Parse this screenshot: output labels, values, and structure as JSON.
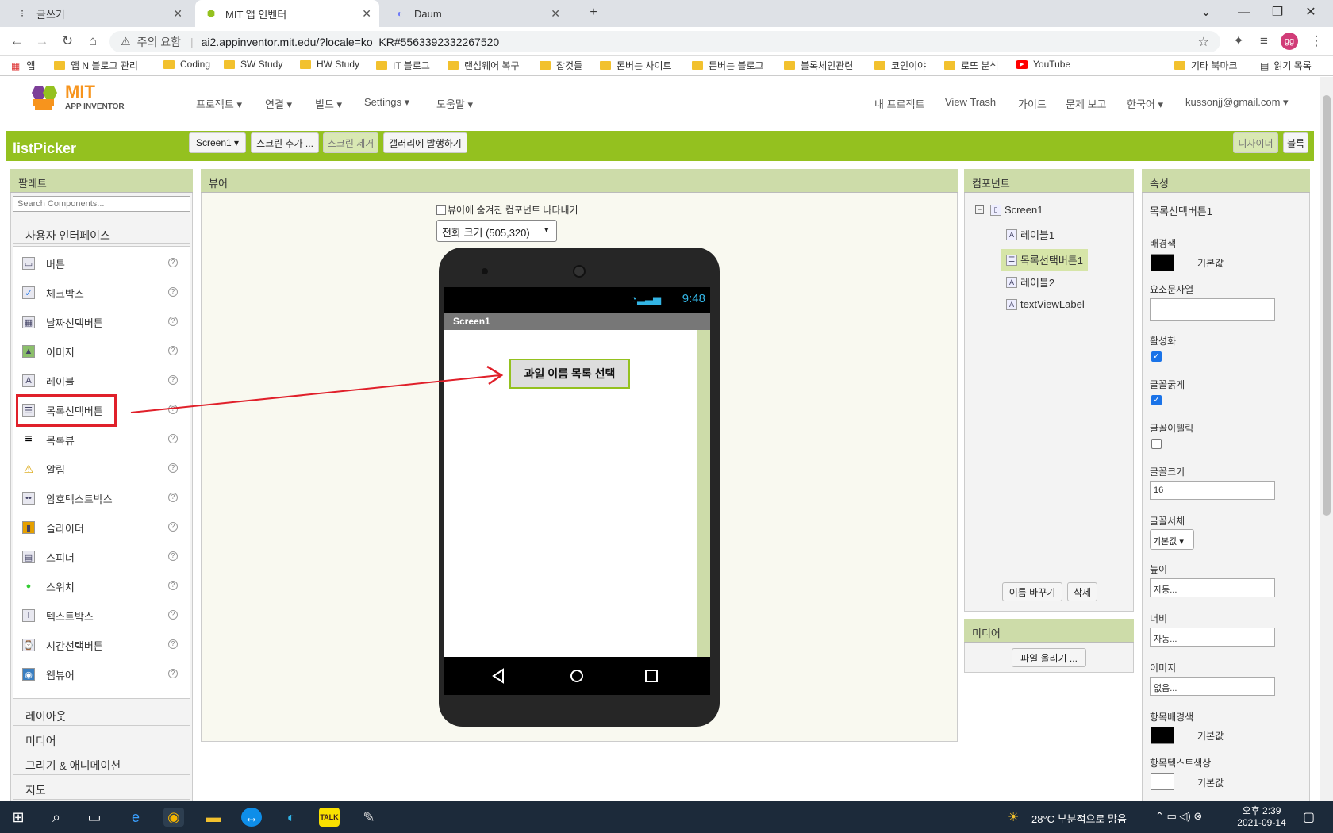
{
  "browser": {
    "tabs": [
      {
        "title": "글쓰기",
        "icon": "blog-icon"
      },
      {
        "title": "MIT 앱 인벤터",
        "icon": "appinventor-icon"
      },
      {
        "title": "Daum",
        "icon": "daum-icon"
      }
    ],
    "security_label": "주의 요함",
    "url": "ai2.appinventor.mit.edu/?locale=ko_KR#5563392332267520",
    "profile_initials": "gg",
    "bookmarks": [
      "앱",
      "앱 N 블로그 관리",
      "Coding",
      "SW Study",
      "HW Study",
      "IT 블로그",
      "랜섬웨어 복구",
      "잡것들",
      "돈버는 사이트",
      "돈버는 블로그",
      "블록체인관련",
      "코인이야",
      "로또 분석",
      "YouTube"
    ],
    "bookmarks_right": [
      "기타 북마크",
      "읽기 목록"
    ]
  },
  "appinventor": {
    "logo_mit": "MIT",
    "logo_sub": "APP INVENTOR",
    "menu": [
      "프로젝트 ▾",
      "연결 ▾",
      "빌드 ▾",
      "Settings ▾",
      "도움말 ▾"
    ],
    "menu_right": [
      "내 프로젝트",
      "View Trash",
      "가이드",
      "문제 보고",
      "한국어 ▾",
      "kussonjj@gmail.com ▾"
    ],
    "project_name": "listPicker",
    "toolbar": {
      "screen_select": "Screen1 ▾",
      "add_screen": "스크린 추가 ...",
      "remove_screen": "스크린 제거",
      "publish_gallery": "갤러리에 발행하기",
      "designer": "디자이너",
      "blocks": "블록"
    },
    "palette": {
      "title": "팔레트",
      "search_placeholder": "Search Components...",
      "category": "사용자 인터페이스",
      "items": [
        "버튼",
        "체크박스",
        "날짜선택버튼",
        "이미지",
        "레이블",
        "목록선택버튼",
        "목록뷰",
        "알림",
        "암호텍스트박스",
        "슬라이더",
        "스피너",
        "스위치",
        "텍스트박스",
        "시간선택버튼",
        "웹뷰어"
      ],
      "other_categories": [
        "레이아웃",
        "미디어",
        "그리기 & 애니메이션",
        "지도"
      ]
    },
    "viewer": {
      "title": "뷰어",
      "show_hidden": "뷰어에 숨겨진 컴포넌트 나타내기",
      "phone_size": "전화 크기 (505,320)",
      "time": "9:48",
      "screen_title": "Screen1",
      "picker_button_text": "과일 이름 목록 선택"
    },
    "components": {
      "title": "컴포넌트",
      "tree": [
        "Screen1",
        "레이블1",
        "목록선택버튼1",
        "레이블2",
        "textViewLabel"
      ],
      "rename": "이름 바꾸기",
      "delete": "삭제"
    },
    "media": {
      "title": "미디어",
      "upload": "파일 올리기 ..."
    },
    "properties": {
      "title": "속성",
      "component": "목록선택버튼1",
      "bg_color_label": "배경색",
      "bg_color_value": "기본값",
      "elements_label": "요소문자열",
      "enabled_label": "활성화",
      "bold_label": "글꼴굵게",
      "italic_label": "글꼴이텔릭",
      "font_size_label": "글꼴크기",
      "font_size_value": "16",
      "font_face_label": "글꼴서체",
      "font_face_value": "기본값 ▾",
      "height_label": "높이",
      "height_value": "자동...",
      "width_label": "너비",
      "width_value": "자동...",
      "image_label": "이미지",
      "image_value": "없음...",
      "item_bg_label": "항목배경색",
      "item_bg_value": "기본값",
      "item_text_label": "항목텍스트색상",
      "item_text_value": "기본값",
      "enabled": true,
      "bold": true,
      "italic": false
    }
  },
  "taskbar": {
    "weather": "28°C 부분적으로 맑음",
    "time": "오후 2:39",
    "date": "2021-09-14"
  },
  "colors": {
    "accent_green": "#94c11f",
    "header_panel": "#cddca9",
    "highlight_red": "#e0202a"
  }
}
